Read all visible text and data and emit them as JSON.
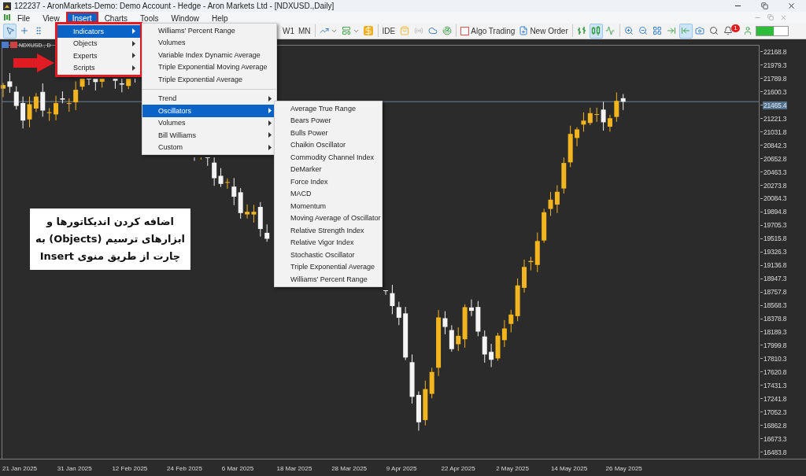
{
  "window": {
    "title": "122237 - AronMarkets-Demo: Demo Account - Hedge - Aron Markets Ltd - [NDXUSD.,Daily]"
  },
  "menu_bar": [
    {
      "label": "File",
      "selected": false
    },
    {
      "label": "View",
      "selected": false
    },
    {
      "label": "Insert",
      "selected": true
    },
    {
      "label": "Charts",
      "selected": false
    },
    {
      "label": "Tools",
      "selected": false
    },
    {
      "label": "Window",
      "selected": false
    },
    {
      "label": "Help",
      "selected": false
    }
  ],
  "toolbar": {
    "left_tools": [
      {
        "kind": "cursor",
        "selected": true
      },
      {
        "kind": "crosshair",
        "selected": false
      },
      {
        "kind": "separator",
        "selected": false
      }
    ],
    "timeframes": [
      {
        "label": "W1",
        "selected": false
      },
      {
        "label": "MN",
        "selected": false
      }
    ],
    "ide": "IDE",
    "algo_trading": {
      "label": "Algo Trading",
      "checked": false
    },
    "new_order": "New Order",
    "chart_tools": [
      {
        "kind": "bars",
        "selected": false
      },
      {
        "kind": "candles",
        "selected": true
      },
      {
        "kind": "line",
        "selected": false
      }
    ],
    "view_tools": [
      {
        "kind": "zoom-in",
        "selected": false
      },
      {
        "kind": "zoom-out",
        "selected": false
      },
      {
        "kind": "tile",
        "selected": false
      },
      {
        "kind": "shift",
        "selected": false
      },
      {
        "kind": "autoscroll",
        "selected": true
      },
      {
        "kind": "screenshot",
        "selected": false
      }
    ],
    "notification_count": "1"
  },
  "chart": {
    "symbol_tab": "NDXUSD., D",
    "price_labels": [
      {
        "text": "22168.8",
        "current": false
      },
      {
        "text": "21979.3",
        "current": false
      },
      {
        "text": "21789.8",
        "current": false
      },
      {
        "text": "21600.3",
        "current": false
      },
      {
        "text": "21465.4",
        "current": true
      },
      {
        "text": "21221.3",
        "current": false
      },
      {
        "text": "21031.8",
        "current": false
      },
      {
        "text": "20842.3",
        "current": false
      },
      {
        "text": "20652.8",
        "current": false
      },
      {
        "text": "20463.3",
        "current": false
      },
      {
        "text": "20273.8",
        "current": false
      },
      {
        "text": "20084.3",
        "current": false
      },
      {
        "text": "19894.8",
        "current": false
      },
      {
        "text": "19705.3",
        "current": false
      },
      {
        "text": "19515.8",
        "current": false
      },
      {
        "text": "19326.3",
        "current": false
      },
      {
        "text": "19136.8",
        "current": false
      },
      {
        "text": "18947.3",
        "current": false
      },
      {
        "text": "18757.8",
        "current": false
      },
      {
        "text": "18568.3",
        "current": false
      },
      {
        "text": "18378.8",
        "current": false
      },
      {
        "text": "18189.3",
        "current": false
      },
      {
        "text": "17999.8",
        "current": false
      },
      {
        "text": "17810.3",
        "current": false
      },
      {
        "text": "17620.8",
        "current": false
      },
      {
        "text": "17431.3",
        "current": false
      },
      {
        "text": "17241.8",
        "current": false
      },
      {
        "text": "17052.3",
        "current": false
      },
      {
        "text": "16862.8",
        "current": false
      },
      {
        "text": "16673.3",
        "current": false
      },
      {
        "text": "16483.8",
        "current": false
      }
    ],
    "dates": [
      "21 Jan 2025",
      "31 Jan 2025",
      "12 Feb 2025",
      "24 Feb 2025",
      "6 Mar 2025",
      "18 Mar 2025",
      "28 Mar 2025",
      "9 Apr 2025",
      "22 Apr 2025",
      "2 May 2025",
      "14 May 2025",
      "26 May 2025"
    ],
    "annotation": [
      "اضافه کردن اندیکاتورها و",
      "ابزارهای ترسیم (Objects) به",
      "چارت از طریق منوی Insert"
    ]
  },
  "insert_menu": [
    {
      "label": "Indicators",
      "selected": true
    },
    {
      "label": "Objects",
      "selected": false
    },
    {
      "label": "Experts",
      "selected": false
    },
    {
      "label": "Scripts",
      "selected": false
    }
  ],
  "indicators_menu": [
    {
      "label": "Williams' Percent Range",
      "kind": "item",
      "selected": false
    },
    {
      "label": "Volumes",
      "kind": "item",
      "selected": false
    },
    {
      "label": "Variable Index Dynamic Average",
      "kind": "item",
      "selected": false
    },
    {
      "label": "Triple Exponential Moving Average",
      "kind": "item",
      "selected": false
    },
    {
      "label": "Triple Exponential Average",
      "kind": "item",
      "selected": false
    },
    {
      "label": "Trend",
      "kind": "submenu",
      "selected": false
    },
    {
      "label": "Oscillators",
      "kind": "submenu",
      "selected": true
    },
    {
      "label": "Volumes",
      "kind": "submenu",
      "selected": false
    },
    {
      "label": "Bill Williams",
      "kind": "submenu",
      "selected": false
    },
    {
      "label": "Custom",
      "kind": "submenu",
      "selected": false
    }
  ],
  "oscillators_menu": [
    "Average True Range",
    "Bears Power",
    "Bulls Power",
    "Chaikin Oscillator",
    "Commodity Channel Index",
    "DeMarker",
    "Force Index",
    "MACD",
    "Momentum",
    "Moving Average of Oscillator",
    "Relative Strength Index",
    "Relative Vigor Index",
    "Stochastic Oscillator",
    "Triple Exponential Average",
    "Williams' Percent Range"
  ]
}
